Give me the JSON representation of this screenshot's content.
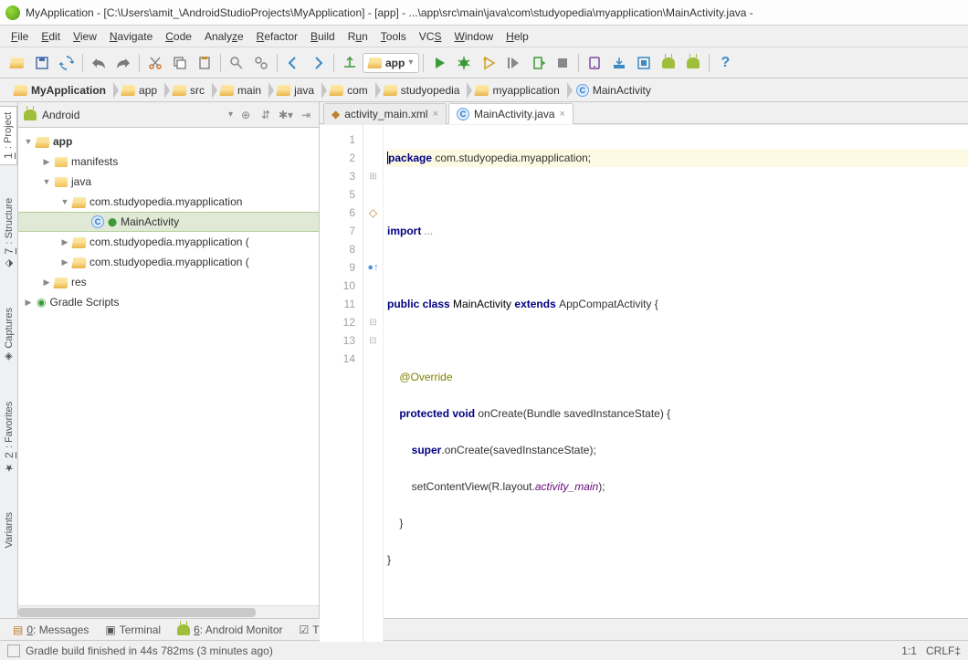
{
  "window": {
    "title": "MyApplication - [C:\\Users\\amit_\\AndroidStudioProjects\\MyApplication] - [app] - ...\\app\\src\\main\\java\\com\\studyopedia\\myapplication\\MainActivity.java -"
  },
  "menu": [
    "File",
    "Edit",
    "View",
    "Navigate",
    "Code",
    "Analyze",
    "Refactor",
    "Build",
    "Run",
    "Tools",
    "VCS",
    "Window",
    "Help"
  ],
  "run_config": {
    "label": "app"
  },
  "breadcrumbs": [
    {
      "icon": "folder-open",
      "label": "MyApplication"
    },
    {
      "icon": "folder-open",
      "label": "app"
    },
    {
      "icon": "folder-open",
      "label": "src"
    },
    {
      "icon": "folder-open",
      "label": "main"
    },
    {
      "icon": "folder-open",
      "label": "java"
    },
    {
      "icon": "folder-open",
      "label": "com"
    },
    {
      "icon": "folder-open",
      "label": "studyopedia"
    },
    {
      "icon": "folder-open",
      "label": "myapplication"
    },
    {
      "icon": "class",
      "label": "MainActivity"
    }
  ],
  "project_panel": {
    "view_selector": "Android",
    "tree": [
      {
        "depth": 0,
        "exp": "down",
        "icon": "folder-open",
        "label": "app",
        "bold": true
      },
      {
        "depth": 1,
        "exp": "right",
        "icon": "folder",
        "label": "manifests"
      },
      {
        "depth": 1,
        "exp": "down",
        "icon": "folder",
        "label": "java"
      },
      {
        "depth": 2,
        "exp": "down",
        "icon": "folder-open",
        "label": "com.studyopedia.myapplication"
      },
      {
        "depth": 3,
        "exp": "",
        "icon": "class",
        "label": "MainActivity",
        "selected": true
      },
      {
        "depth": 2,
        "exp": "right",
        "icon": "folder-open",
        "label": "com.studyopedia.myapplication ("
      },
      {
        "depth": 2,
        "exp": "right",
        "icon": "folder-open",
        "label": "com.studyopedia.myapplication ("
      },
      {
        "depth": 1,
        "exp": "right",
        "icon": "folder-open",
        "label": "res"
      },
      {
        "depth": 0,
        "exp": "right",
        "icon": "gradle",
        "label": "Gradle Scripts"
      }
    ]
  },
  "left_gutter": [
    {
      "num": "1",
      "label": "Project",
      "active": true
    },
    {
      "num": "7",
      "label": "Structure"
    },
    {
      "num": "",
      "label": "Captures"
    },
    {
      "num": "2",
      "label": "Favorites"
    },
    {
      "num": "",
      "label": "Variants"
    }
  ],
  "editor": {
    "tabs": [
      {
        "icon": "xml",
        "label": "activity_main.xml",
        "active": false
      },
      {
        "icon": "class",
        "label": "MainActivity.java",
        "active": true
      }
    ],
    "lines": [
      "1",
      "2",
      "3",
      "5",
      "6",
      "7",
      "8",
      "9",
      "10",
      "11",
      "12",
      "13",
      "14"
    ],
    "code": {
      "l1_pre": "p",
      "l1a": "ackage",
      "l1b": " com.studyopedia.myapplication;",
      "l3a": "import ",
      "l3b": "...",
      "l6a": "public class ",
      "l6b": "MainActivity ",
      "l6c": "extends ",
      "l6d": "AppCompatActivity {",
      "l8a": "    @Override",
      "l9a": "    ",
      "l9b": "protected void ",
      "l9c": "onCreate(Bundle savedInstanceState) {",
      "l10a": "        ",
      "l10b": "super",
      "l10c": ".onCreate(savedInstanceState);",
      "l11a": "        setContentView(R.layout.",
      "l11b": "activity_main",
      "l11c": ");",
      "l12": "    }",
      "l13": "}"
    }
  },
  "bottom_tool_buttons": [
    {
      "label": "0: Messages",
      "u": "0"
    },
    {
      "label": "Terminal"
    },
    {
      "label": "6: Android Monitor",
      "u": "6"
    },
    {
      "label": "TODO"
    }
  ],
  "status": {
    "message": "Gradle build finished in 44s 782ms (3 minutes ago)",
    "pos": "1:1",
    "encoding": "CRLF‡"
  }
}
